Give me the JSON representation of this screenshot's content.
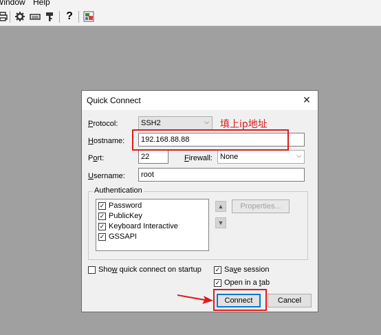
{
  "menu": {
    "window": "Window",
    "help": "Help"
  },
  "toolbar": {
    "icons": [
      "print-icon",
      "gear-icon",
      "keymap-icon",
      "key-icon",
      "help-icon",
      "session-icon"
    ],
    "help_glyph": "?"
  },
  "dialog": {
    "title": "Quick Connect",
    "close_glyph": "✕",
    "protocol": {
      "label": "Protocol:",
      "value": "SSH2"
    },
    "hostname": {
      "label": "Hostname:",
      "value": "192.168.88.88"
    },
    "port": {
      "label": "Port:",
      "value": "22"
    },
    "firewall": {
      "label": "Firewall:",
      "value": "None"
    },
    "username": {
      "label": "Username:",
      "value": "root"
    },
    "authentication": {
      "label": "Authentication",
      "methods": [
        {
          "name": "Password",
          "checked": true
        },
        {
          "name": "PublicKey",
          "checked": true
        },
        {
          "name": "Keyboard Interactive",
          "checked": true
        },
        {
          "name": "GSSAPI",
          "checked": true
        }
      ],
      "properties_button": "Properties..."
    },
    "show_on_startup": {
      "label": "Show quick connect on startup",
      "checked": false
    },
    "save_session": {
      "label": "Save session",
      "checked": true
    },
    "open_in_tab": {
      "label": "Open in a tab",
      "checked": true
    },
    "connect_button": "Connect",
    "cancel_button": "Cancel"
  },
  "annotation": {
    "text": "填上ip地址",
    "color": "#e0191b"
  },
  "colors": {
    "accent": "#0078d7",
    "annotation": "#e0191b",
    "workspace": "#a0a0a0"
  }
}
